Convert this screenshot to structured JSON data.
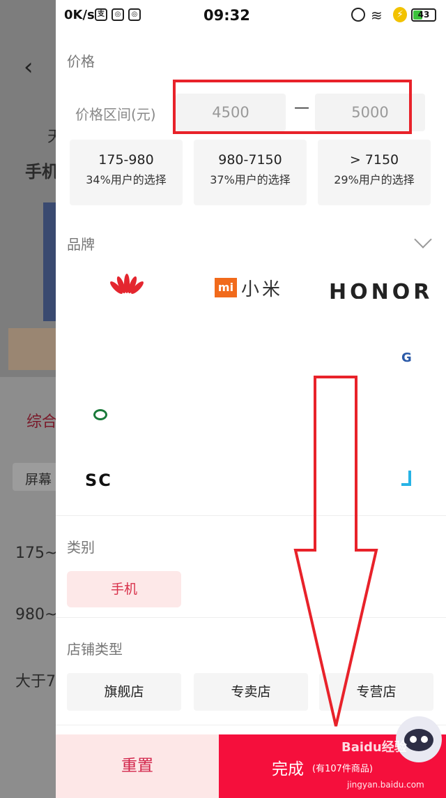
{
  "status_bar": {
    "speed": "0K/s",
    "time": "09:32",
    "battery": "43",
    "battery_level": 0.43
  },
  "background": {
    "partial_texts": [
      "天",
      "手机",
      "综合",
      "屏幕",
      "175~",
      "980~",
      "大于7"
    ]
  },
  "filter": {
    "price": {
      "title": "价格",
      "range_label": "价格区间(元)",
      "min_value": "4500",
      "max_value": "5000",
      "separator": "—",
      "options": [
        {
          "range": "175-980",
          "share": "34%用户的选择"
        },
        {
          "range": "980-7150",
          "share": "37%用户的选择"
        },
        {
          "range": "> 7150",
          "share": "29%用户的选择"
        }
      ]
    },
    "brand": {
      "title": "品牌",
      "logos": {
        "mi_mark": "mi",
        "mi_text": "小米",
        "honor": "HONOR",
        "partial_g": "G",
        "partial_sc": "SC"
      }
    },
    "category": {
      "title": "类别",
      "selected": "手机"
    },
    "shop_type": {
      "title": "店铺类型",
      "options": [
        "旗舰店",
        "专卖店",
        "专营店"
      ]
    },
    "actions": {
      "reset": "重置",
      "done": "完成",
      "done_sub": "(有107件商品)"
    }
  },
  "watermark": {
    "brand": "Baidu经验",
    "url": "jingyan.baidu.com"
  },
  "colors": {
    "accent": "#f50f3c",
    "highlight_box": "#e8222a",
    "chip_bg": "#fde8e8"
  }
}
